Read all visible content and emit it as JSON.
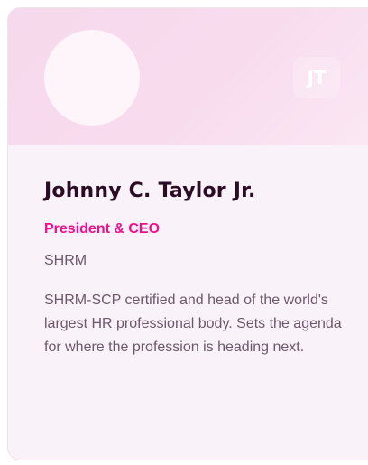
{
  "card": {
    "initials": "JT",
    "name": "Johnny C. Taylor Jr.",
    "role": "President & CEO",
    "organization": "SHRM",
    "bio": "SHRM-SCP certified and head of the world's largest HR professional body. Sets the agenda for where the profession is heading next."
  },
  "colors": {
    "header_background": "#f7dbed",
    "card_background": "#f9f2f8",
    "role_accent": "#ef0f8c",
    "name_text": "#2a0c24",
    "body_text": "#6c586a"
  }
}
